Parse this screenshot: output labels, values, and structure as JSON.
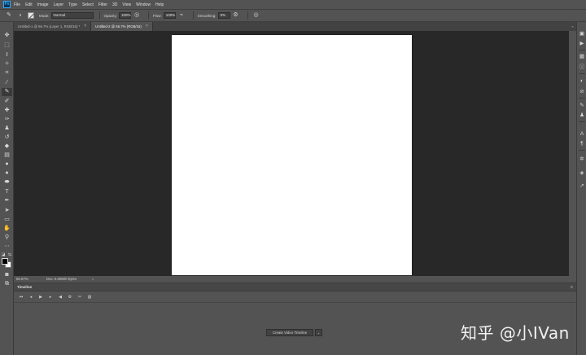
{
  "menubar": {
    "logo": "Ps",
    "items": [
      "File",
      "Edit",
      "Image",
      "Layer",
      "Type",
      "Select",
      "Filter",
      "3D",
      "View",
      "Window",
      "Help"
    ]
  },
  "options": {
    "brush_size": "5",
    "mode_label": "Mode:",
    "mode_value": "Normal",
    "opacity_label": "Opacity:",
    "opacity_value": "100%",
    "flow_label": "Flow:",
    "flow_value": "100%",
    "smoothing_label": "Smoothing:",
    "smoothing_value": "0%"
  },
  "tabs": [
    {
      "label": "Untitled-1 @ 66.7% (Layer 1, RGB/16) *",
      "active": false
    },
    {
      "label": "Untitled-2 @ 66.7% (RGB/16)",
      "active": true
    }
  ],
  "status": {
    "zoom": "66.67%",
    "doc_info": "Doc: 6.00M/0 bytes",
    "arrow": ">"
  },
  "timeline": {
    "title": "Timeline",
    "menu": "≡",
    "create_button": "Create Video Timeline",
    "dropdown": "⌄"
  },
  "canvas": {
    "background": "#ffffff",
    "workspace_color": "#282828"
  },
  "watermark": "知乎 @小IVan"
}
